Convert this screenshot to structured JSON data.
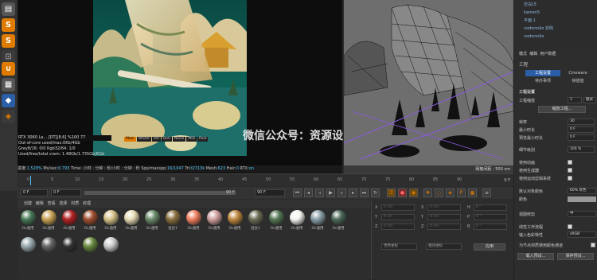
{
  "render_stats": {
    "gpu": "RTX 3060 La... [DT][8.6]",
    "pct": "%100",
    "temp": "77",
    "out_of_core": "Out-of-core used/max:0Kb/4Gb",
    "grey": "Grey8/16: 0/0",
    "rgb": "Rgb32/64: 1/0",
    "vram": "Used/free/total vram: 1.48Gb/1.735Gb/6Gb"
  },
  "status_line": {
    "progress": "进度:",
    "progress_val": "1.528%",
    "ms": "Ms/sec:",
    "ms_val": "0.793",
    "time": "Time: 小时 : 分钟 : 秒/小时 : 分钟 : 秒",
    "spp": "Spp/maxspp:",
    "spp_val": "16/1047",
    "tri": "Tri:",
    "tri_val": "0/713k",
    "mesh": "Mesh:",
    "mesh_val": "623",
    "hair": "Hair:",
    "hair_val": "0",
    "rtx": "RTX:",
    "rtx_val": "on"
  },
  "viewer_tabs": [
    "Main",
    "Whale",
    "Ref",
    "Beh",
    "Noise",
    "MID",
    "Post"
  ],
  "watermark": "微信公众号：资源设",
  "viewport": {
    "grid_label": "网格间距 : 500 cm"
  },
  "timeline": {
    "ticks": [
      "0",
      "5",
      "10",
      "15",
      "20",
      "25",
      "30",
      "35",
      "40",
      "45",
      "50",
      "55",
      "60",
      "65",
      "70",
      "75",
      "80",
      "85",
      "90"
    ],
    "frame_end": "0 F"
  },
  "transport": {
    "start": "0 F",
    "current": "0 F",
    "end": "90 F",
    "max": "90 F"
  },
  "material_menu": [
    "创建",
    "编辑",
    "查看",
    "选择",
    "材质",
    "纹理"
  ],
  "materials": [
    {
      "label": "Oc通用",
      "color": "#4a7a5a"
    },
    {
      "label": "Oc通用",
      "color": "#c9a356"
    },
    {
      "label": "Oc通用",
      "color": "#b22222"
    },
    {
      "label": "Oc通用",
      "color": "#a05030"
    },
    {
      "label": "Oc通用",
      "color": "#d6c28a"
    },
    {
      "label": "Oc通用",
      "color": "#e8dcb5"
    },
    {
      "label": "Oc通用",
      "color": "#6a8a6a"
    },
    {
      "label": "混合1",
      "color": "#8a7040"
    },
    {
      "label": "Oc通用",
      "color": "#f08060"
    },
    {
      "label": "Oc通用",
      "color": "#d0a0a0"
    },
    {
      "label": "Oc通用",
      "color": "#c08840"
    },
    {
      "label": "混合1",
      "color": "#6d6d55"
    },
    {
      "label": "Oc通用",
      "color": "#557755"
    },
    {
      "label": "Oc通用",
      "color": "#f4f4f0"
    },
    {
      "label": "Oc通用",
      "color": "#8aa0a8"
    },
    {
      "label": "Oc通用",
      "color": "#4d6a5a"
    },
    {
      "label": "",
      "color": "#9aaab0"
    },
    {
      "label": "",
      "color": "#666666"
    },
    {
      "label": "",
      "color": "#333333"
    },
    {
      "label": "",
      "color": "#6a8a40"
    },
    {
      "label": "",
      "color": "#cccccc"
    }
  ],
  "coords": {
    "rows": [
      {
        "axis": "X",
        "v": "0 cm",
        "axis2": "X",
        "v2": "0 cm",
        "axis3": "H",
        "v3": "0 °"
      },
      {
        "axis": "Y",
        "v": "0 cm",
        "axis2": "Y",
        "v2": "0 cm",
        "axis3": "P",
        "v3": "0 °"
      },
      {
        "axis": "Z",
        "v": "0 cm",
        "axis2": "Z",
        "v2": "0 cm",
        "axis3": "B",
        "v3": "0 °"
      }
    ],
    "dd1": "世界坐标",
    "dd2": "相对坐标",
    "apply": "应用"
  },
  "objects": [
    "空白L5",
    "kamen5",
    "平面.1",
    "vodorosliz 实例",
    "vodorosliz"
  ],
  "attr": {
    "menu": [
      "模式",
      "编辑",
      "用户数据"
    ],
    "title": "工程",
    "tabs": [
      "工程设置",
      "Cineware",
      "待办事项",
      "帧插值"
    ],
    "section": "工程设置",
    "rows": {
      "scale_label": "工程缩放",
      "scale_val": "1",
      "scale_unit": "厘米",
      "scale_btn": "缩放工程...",
      "fps_label": "帧率",
      "fps_val": "30",
      "min_label": "最小时长",
      "min_val": "0 F",
      "preview_min_label": "预览最小时长",
      "preview_min_val": "0 F",
      "lod_label": "细节级别",
      "lod_val": "100 %",
      "anim_label": "使用动画",
      "gen_label": "使用生成器",
      "motion_label": "使用运动剪辑系统",
      "default_label": "默认对象颜色",
      "default_val": "60% 灰色",
      "color_label": "颜色",
      "view_label": "视图修剪",
      "view_val": "中",
      "linear_label": "线性工作流程",
      "input_label": "输入色彩特性",
      "input_val": "sRGB",
      "node_label": "为节点材质使用颜色通道",
      "load_btn": "载入预设...",
      "save_btn": "保存预设..."
    }
  },
  "colors": {
    "accent_blue": "#2a5fa8",
    "highlight_orange": "#e07b00",
    "wire_purple": "#8a5adf"
  }
}
